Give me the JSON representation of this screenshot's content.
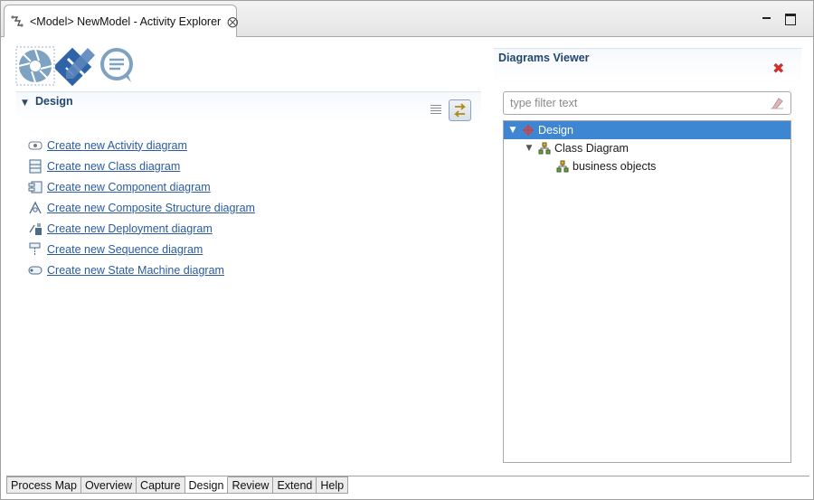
{
  "editor": {
    "tab_title": "<Model> NewModel - Activity Explorer",
    "close_glyph": "⨂"
  },
  "icons": {
    "app": "activity-explorer-icon",
    "top": [
      "shutter-icon",
      "pencil-icon",
      "speech-bubble-icon"
    ]
  },
  "design_section": {
    "title": "Design",
    "links": [
      {
        "label": "Create new Activity diagram",
        "icon": "activity-diagram-icon"
      },
      {
        "label": "Create new Class diagram",
        "icon": "class-diagram-icon"
      },
      {
        "label": "Create new Component diagram",
        "icon": "component-diagram-icon"
      },
      {
        "label": "Create new Composite Structure diagram",
        "icon": "composite-structure-icon"
      },
      {
        "label": "Create new Deployment diagram",
        "icon": "deployment-diagram-icon"
      },
      {
        "label": "Create new Sequence diagram",
        "icon": "sequence-diagram-icon"
      },
      {
        "label": "Create new State Machine diagram",
        "icon": "state-machine-icon"
      }
    ]
  },
  "diagrams_viewer": {
    "title": "Diagrams Viewer",
    "filter_placeholder": "type filter text",
    "tree": [
      {
        "label": "Design",
        "level": 0,
        "expanded": true,
        "selected": true
      },
      {
        "label": "Class Diagram",
        "level": 1,
        "expanded": true,
        "selected": false
      },
      {
        "label": "business objects",
        "level": 2,
        "expanded": false,
        "selected": false
      }
    ]
  },
  "page_tabs": [
    {
      "label": "Process Map",
      "active": false
    },
    {
      "label": "Overview",
      "active": false
    },
    {
      "label": "Capture",
      "active": false
    },
    {
      "label": "Design",
      "active": true
    },
    {
      "label": "Review",
      "active": false
    },
    {
      "label": "Extend",
      "active": false
    },
    {
      "label": "Help",
      "active": false
    }
  ],
  "colors": {
    "link": "#2a5ba0",
    "section_title": "#22466e",
    "selection": "#3f86d2",
    "close_red": "#d03030"
  }
}
